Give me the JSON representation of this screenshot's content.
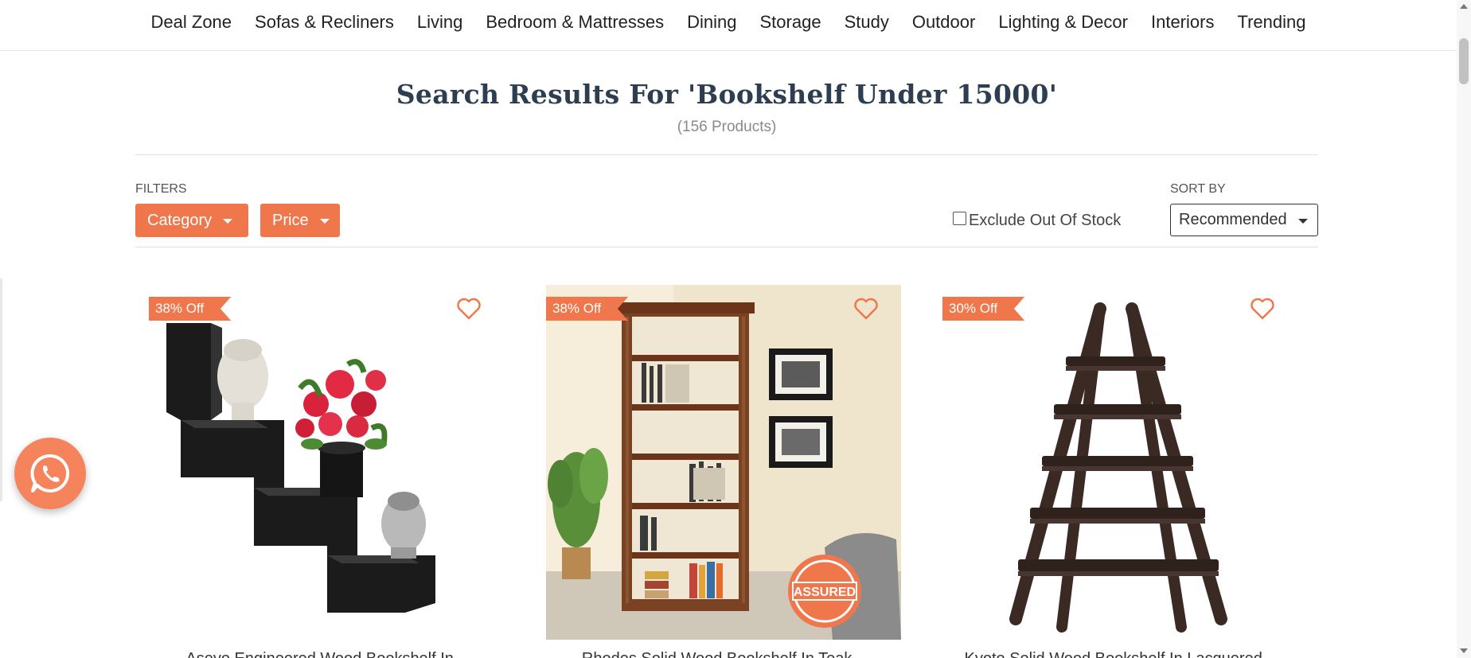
{
  "nav": {
    "items": [
      {
        "label": "Deal Zone"
      },
      {
        "label": "Sofas & Recliners"
      },
      {
        "label": "Living"
      },
      {
        "label": "Bedroom & Mattresses"
      },
      {
        "label": "Dining"
      },
      {
        "label": "Storage"
      },
      {
        "label": "Study"
      },
      {
        "label": "Outdoor"
      },
      {
        "label": "Lighting & Decor"
      },
      {
        "label": "Interiors"
      },
      {
        "label": "Trending"
      }
    ]
  },
  "results": {
    "title": "Search Results For 'Bookshelf Under 15000'",
    "count": "(156 Products)"
  },
  "filters": {
    "label": "FILTERS",
    "category_label": "Category",
    "price_label": "Price",
    "exclude_out_of_stock": "Exclude Out Of Stock",
    "exclude_checked": false
  },
  "sort": {
    "label": "SORT BY",
    "selected": "Recommended"
  },
  "products": [
    {
      "discount": "38% Off",
      "name": "Aseyo Engineered Wood Bookshelf In..."
    },
    {
      "discount": "38% Off",
      "name": "Rhodes Solid Wood Bookshelf In Teak..."
    },
    {
      "discount": "30% Off",
      "name": "Kyoto Solid Wood Bookshelf In Lacquered..."
    }
  ],
  "colors": {
    "accent": "#f0764b",
    "title": "#2c3e50",
    "whatsapp": "#f5845c"
  },
  "icons": {
    "wishlist": "heart-outline-icon",
    "whatsapp": "whatsapp-icon",
    "dropdown": "caret-down-icon"
  }
}
